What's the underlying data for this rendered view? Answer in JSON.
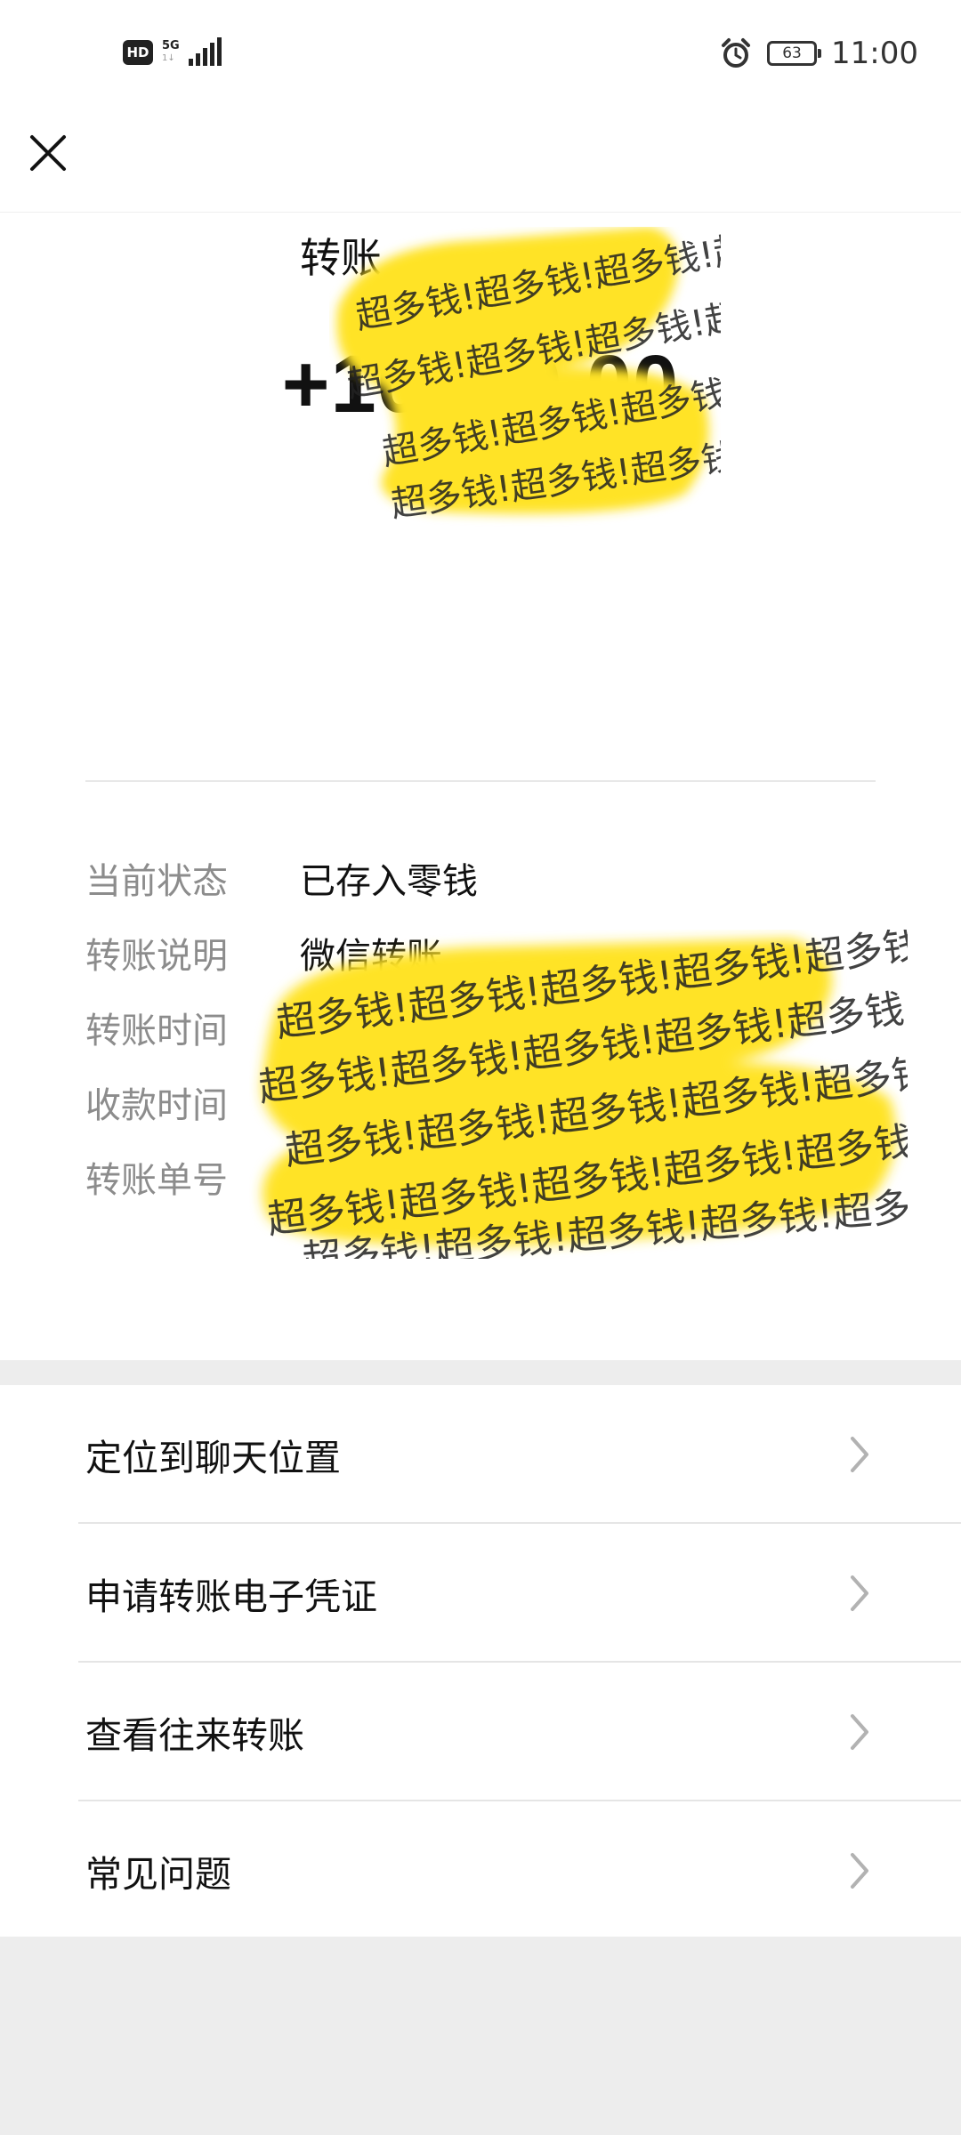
{
  "status_bar": {
    "hd": "HD",
    "network": "5G",
    "network_sub": "1↓",
    "battery": "63",
    "time": "11:00"
  },
  "nav": {
    "close_icon": "close-icon"
  },
  "transfer": {
    "title": "转账",
    "amount": "+10000.00"
  },
  "info": [
    {
      "label": "当前状态",
      "value": "已存入零钱"
    },
    {
      "label": "转账说明",
      "value": "微信转账"
    },
    {
      "label": "转账时间",
      "value": ""
    },
    {
      "label": "收款时间",
      "value": ""
    },
    {
      "label": "转账单号",
      "value": ""
    }
  ],
  "redaction_text": "超多钱!超多钱!超多钱!超多钱!超多钱!",
  "actions": [
    {
      "label": "定位到聊天位置"
    },
    {
      "label": "申请转账电子凭证"
    },
    {
      "label": "查看往来转账"
    },
    {
      "label": "常见问题"
    }
  ],
  "colors": {
    "background": "#ededed",
    "card": "#ffffff",
    "redaction": "#ffe326",
    "label_gray": "#8c8c8c"
  }
}
